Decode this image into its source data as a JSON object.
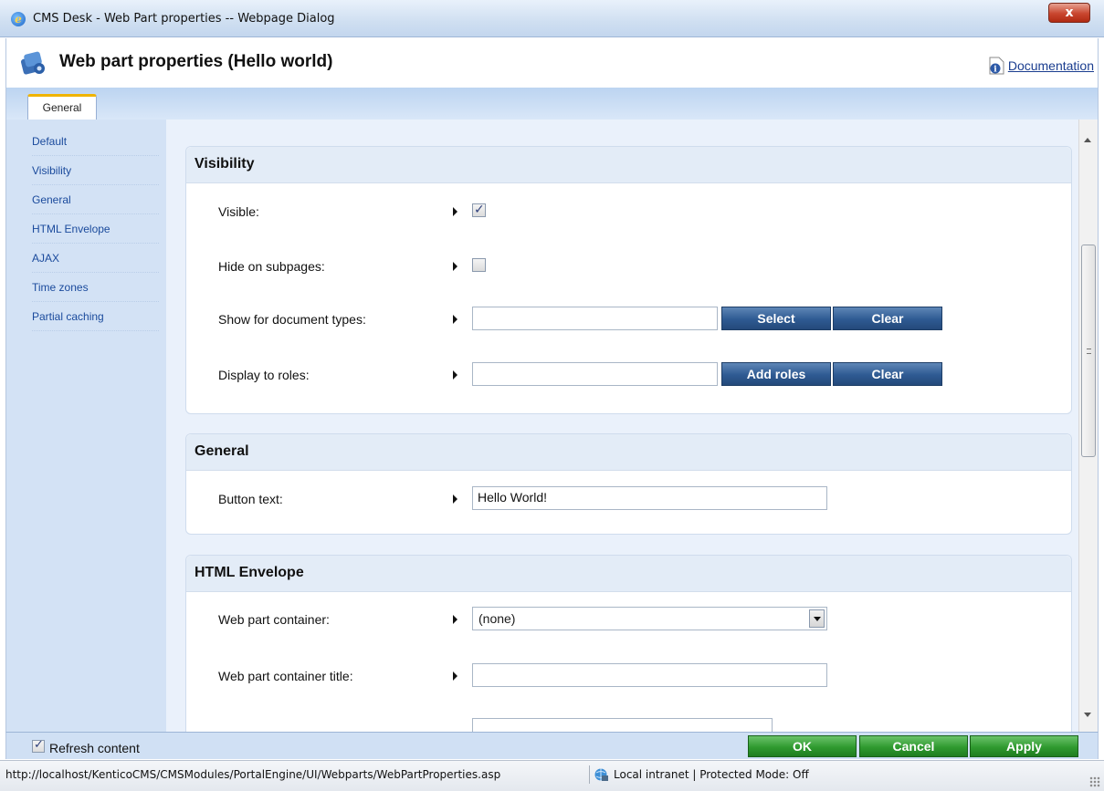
{
  "window": {
    "title": "CMS Desk - Web Part properties -- Webpage Dialog",
    "close_label": "x"
  },
  "header": {
    "title": "Web part properties (Hello world)",
    "doc_link": "Documentation"
  },
  "tabs": [
    {
      "label": "General"
    }
  ],
  "sidebar": {
    "items": [
      {
        "label": "Default"
      },
      {
        "label": "Visibility"
      },
      {
        "label": "General"
      },
      {
        "label": "HTML Envelope"
      },
      {
        "label": "AJAX"
      },
      {
        "label": "Time zones"
      },
      {
        "label": "Partial caching"
      }
    ]
  },
  "visibility": {
    "heading": "Visibility",
    "visible_label": "Visible:",
    "visible_checked": true,
    "hide_label": "Hide on subpages:",
    "hide_checked": false,
    "doctypes_label": "Show for document types:",
    "doctypes_value": "",
    "select_btn": "Select",
    "clear_btn": "Clear",
    "roles_label": "Display to roles:",
    "roles_value": "",
    "add_roles_btn": "Add roles",
    "clear_btn2": "Clear"
  },
  "general": {
    "heading": "General",
    "button_text_label": "Button text:",
    "button_text_value": "Hello World!"
  },
  "html_envelope": {
    "heading": "HTML Envelope",
    "container_label": "Web part container:",
    "container_value": "(none)",
    "container_title_label": "Web part container title:",
    "container_title_value": ""
  },
  "footer": {
    "refresh_label": "Refresh content",
    "refresh_checked": true,
    "ok": "OK",
    "cancel": "Cancel",
    "apply": "Apply"
  },
  "statusbar": {
    "url": "http://localhost/KenticoCMS/CMSModules/PortalEngine/UI/Webparts/WebPartProperties.asp",
    "zone": "Local intranet | Protected Mode: Off"
  }
}
